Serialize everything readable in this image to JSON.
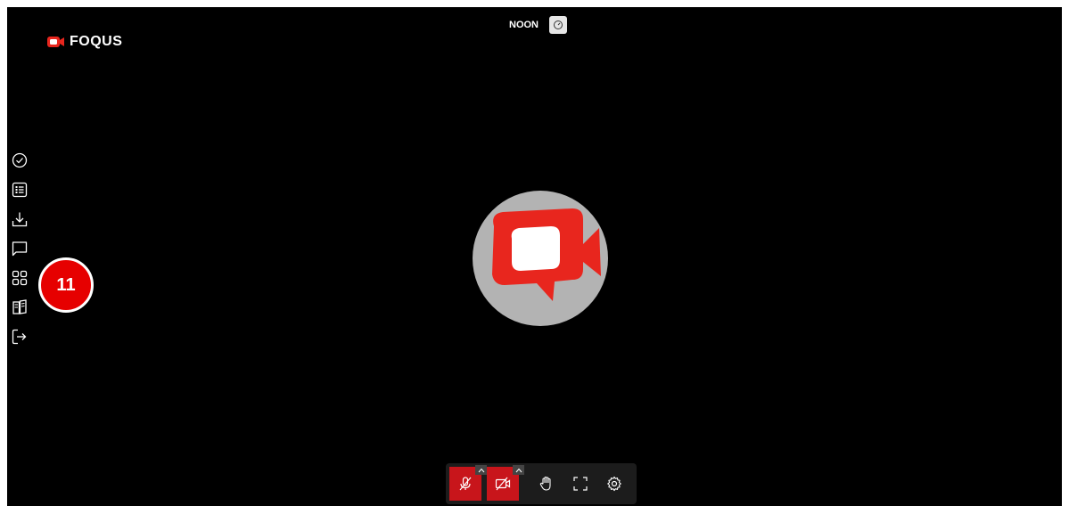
{
  "app": {
    "logo_text": "FOQUS",
    "brand_color": "#e8261e"
  },
  "header": {
    "room_name": "NOON",
    "speed_icon": "speedometer-icon"
  },
  "sidebar": {
    "items": [
      {
        "icon": "check-circle-icon"
      },
      {
        "icon": "list-icon"
      },
      {
        "icon": "download-icon"
      },
      {
        "icon": "chat-icon"
      },
      {
        "icon": "grid-icon"
      },
      {
        "icon": "book-icon"
      },
      {
        "icon": "exit-icon"
      }
    ]
  },
  "annotation": {
    "number": "11",
    "color": "#e60000"
  },
  "controls": {
    "mic": {
      "icon": "mic-off-icon",
      "state": "muted"
    },
    "camera": {
      "icon": "camera-off-icon",
      "state": "off"
    },
    "hand": {
      "icon": "raise-hand-icon"
    },
    "fullscreen": {
      "icon": "fullscreen-icon"
    },
    "settings": {
      "icon": "settings-gear-icon"
    },
    "active_color": "#c8151b"
  }
}
